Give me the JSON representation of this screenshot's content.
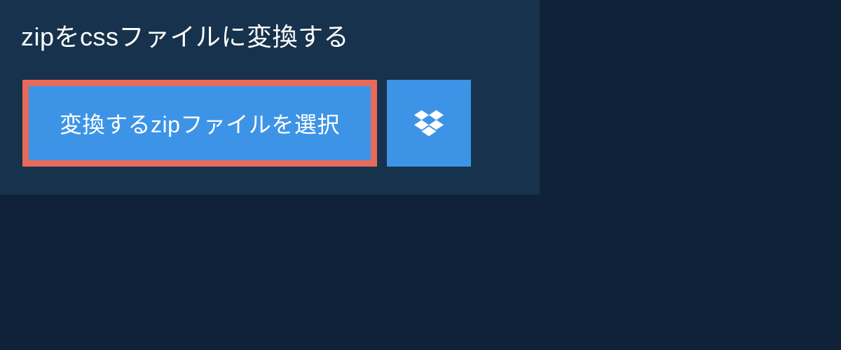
{
  "heading": "zipをcssファイルに変換する",
  "buttons": {
    "select_file_label": "変換するzipファイルを選択"
  }
}
